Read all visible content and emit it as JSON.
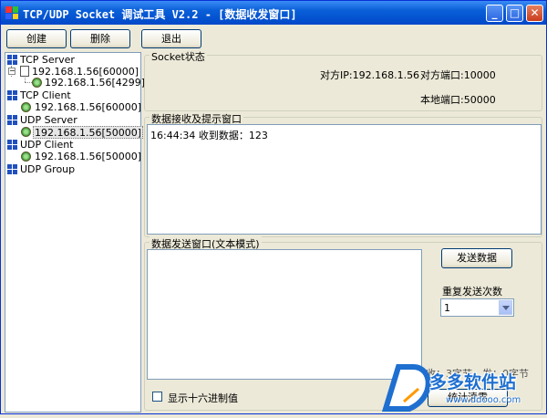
{
  "window": {
    "title": "TCP/UDP Socket 调试工具 V2.2 - [数据收发窗口]",
    "controls": {
      "minimize": "_",
      "maximize": "□",
      "close": "✕"
    }
  },
  "toolbar": {
    "create": "创建",
    "delete": "删除",
    "exit": "退出"
  },
  "tree": {
    "tcp_server": "TCP Server",
    "tcp_server_host": "192.168.1.56[60000]",
    "tcp_server_conn": "192.168.1.56[4299]",
    "tcp_client": "TCP Client",
    "tcp_client_conn": "192.168.1.56[60000]",
    "udp_server": "UDP Server",
    "udp_server_conn": "192.168.1.56[50000]",
    "udp_client": "UDP Client",
    "udp_client_conn": "192.168.1.56[50000]",
    "udp_group": "UDP Group"
  },
  "socket_status": {
    "title": "Socket状态",
    "remote_ip": "对方IP:192.168.1.56",
    "remote_port": "对方端口:10000",
    "local_port": "本地端口:50000"
  },
  "receive": {
    "title": "数据接收及提示窗口",
    "log": "16:44:34 收到数据：123"
  },
  "send": {
    "title": "数据发送窗口(文本模式)",
    "send_button": "发送数据",
    "repeat_label": "重复发送次数",
    "repeat_value": "1",
    "stats": "收：3字节，发：0字节",
    "clear_button": "统计清零",
    "hex_checkbox_label": "显示十六进制值"
  },
  "watermark": {
    "text": "多多软件站",
    "url": "www.ddooo.com"
  },
  "colors": {
    "titlebar": "#0a5fd8",
    "face": "#ece9d8",
    "field_border": "#7f9db9",
    "watermark": "#1e6fd0"
  }
}
